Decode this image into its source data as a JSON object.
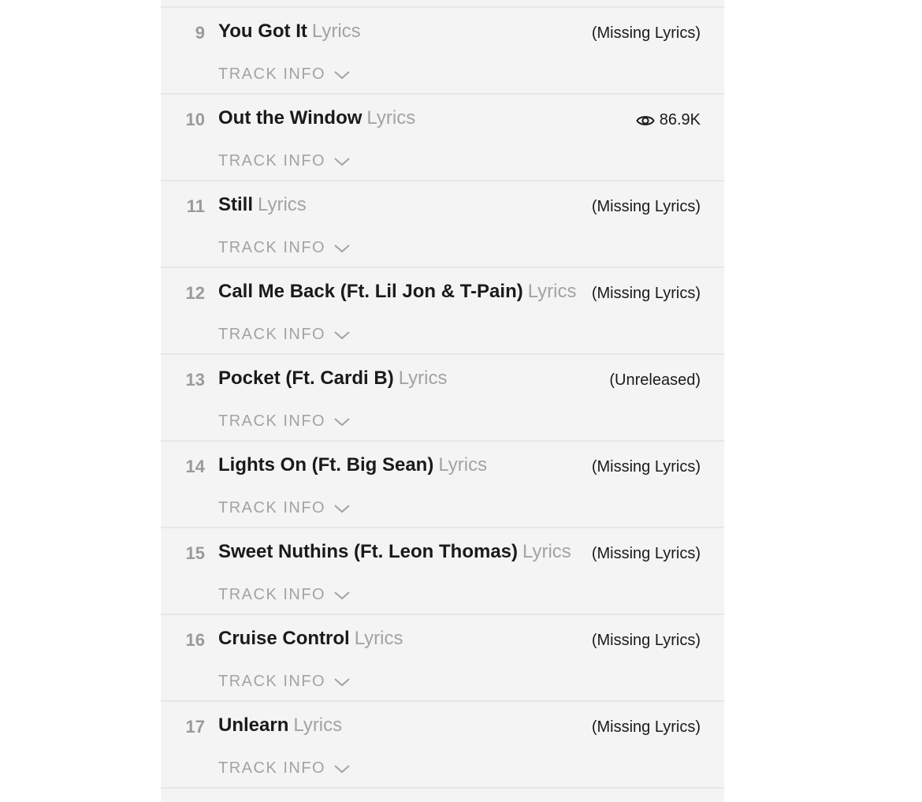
{
  "lyrics_word": "Lyrics",
  "track_info_label": "TRACK INFO",
  "tracks": [
    {
      "number": "9",
      "title": "You Got It",
      "status": "(Missing Lyrics)"
    },
    {
      "number": "10",
      "title": "Out the Window",
      "views": "86.9K",
      "status_icon": "eye-icon"
    },
    {
      "number": "11",
      "title": "Still",
      "status": "(Missing Lyrics)"
    },
    {
      "number": "12",
      "title": "Call Me Back (Ft. Lil Jon & T-Pain)",
      "status": "(Missing Lyrics)"
    },
    {
      "number": "13",
      "title": "Pocket (Ft. Cardi B)",
      "status": "(Unreleased)"
    },
    {
      "number": "14",
      "title": "Lights On (Ft. Big Sean)",
      "status": "(Missing Lyrics)"
    },
    {
      "number": "15",
      "title": "Sweet Nuthins (Ft. Leon Thomas)",
      "status": "(Missing Lyrics)"
    },
    {
      "number": "16",
      "title": "Cruise Control",
      "status": "(Missing Lyrics)"
    },
    {
      "number": "17",
      "title": "Unlearn",
      "status": "(Missing Lyrics)"
    }
  ]
}
